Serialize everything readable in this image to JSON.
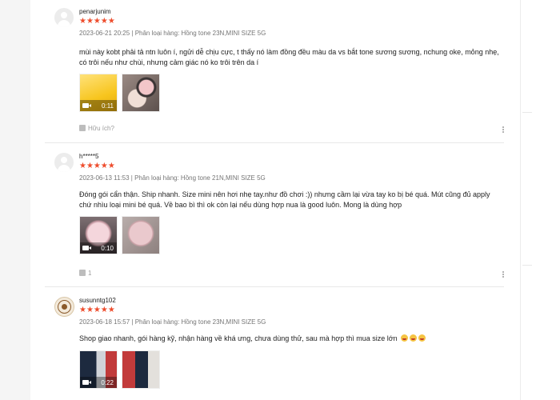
{
  "reviews": [
    {
      "username": "penarjunim",
      "stars": "★★★★★",
      "meta": "2023-06-21 20:25 | Phân loại hàng: Hồng tone 23N,MINI SIZE 5G",
      "content": "mùi này kobt phải tả ntn luôn í, ngửi dễ chịu cực, t thấy nó làm đồng đều màu da vs bắt tone sương sương, nchung oke, mỏng nhẹ, có trôi nếu như chùi, nhưng cảm giác nó ko trôi trên da í",
      "video_duration": "0:11",
      "helpful_label": "Hữu ích?"
    },
    {
      "username": "h*****5",
      "stars": "★★★★★",
      "meta": "2023-06-13 11:53 | Phân loại hàng: Hồng tone 21N,MINI SIZE 5G",
      "content": "Đóng gói cẩn thận. Ship nhanh. Size mini nên hơi nhẹ tay.như đồ chơi :)) nhưng cầm lại vừa tay ko bị bé quá. Mút cũng đủ apply chứ nhìu loại mini bé quá. Về bao bì thì ok còn lại nếu dùng hợp nua là good luôn. Mong là dùng hợp",
      "video_duration": "0:10",
      "helpful_count": "1"
    },
    {
      "username": "susunntg102",
      "stars": "★★★★★",
      "meta": "2023-06-18 15:57 | Phân loại hàng: Hồng tone 23N,MINI SIZE 5G",
      "content": "Shop giao nhanh, gói hàng kỹ, nhận hàng về khá ưng, chưa dùng thử, sau mà hợp thì mua size lớn",
      "video_duration": "0:22"
    }
  ],
  "icons": {
    "avatar_default": "user-silhouette-icon",
    "video": "video-camera-icon",
    "thumbs_up": "thumbs-up-icon",
    "more": "more-vertical-icon",
    "emoji": "smiling-face-icon"
  },
  "colors": {
    "star": "#ee4d2d",
    "text": "#222222",
    "meta": "#757575"
  }
}
